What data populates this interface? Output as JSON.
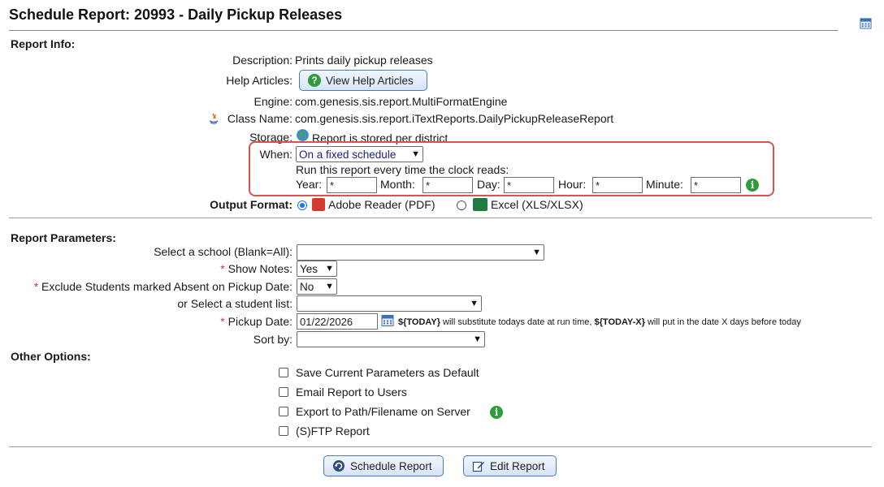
{
  "header": {
    "title": "Schedule Report: 20993 - Daily Pickup Releases"
  },
  "report_info": {
    "section_label": "Report Info:",
    "description_label": "Description:",
    "description_value": "Prints daily pickup releases",
    "help_label": "Help Articles:",
    "help_button": "View Help Articles",
    "engine_label": "Engine:",
    "engine_value": "com.genesis.sis.report.MultiFormatEngine",
    "class_label": "Class Name:",
    "class_value": "com.genesis.sis.report.iTextReports.DailyPickupReleaseReport",
    "storage_label": "Storage:",
    "storage_value": "Report is stored per district",
    "when_label": "When:",
    "when_value": "On a fixed schedule",
    "schedule_note": "Run this report every time the clock reads:",
    "year_label": "Year:",
    "year_value": "*",
    "month_label": "Month:",
    "month_value": "*",
    "day_label": "Day:",
    "day_value": "*",
    "hour_label": "Hour:",
    "hour_value": "*",
    "minute_label": "Minute:",
    "minute_value": "*",
    "output_label": "Output Format:",
    "output_pdf": "Adobe Reader (PDF)",
    "output_xls": "Excel (XLS/XLSX)"
  },
  "parameters": {
    "section_label": "Report Parameters:",
    "school_label": "Select a school (Blank=All):",
    "school_value": "",
    "notes_label": "Show Notes:",
    "notes_value": "Yes",
    "exclude_label": "Exclude Students marked Absent on Pickup Date:",
    "exclude_value": "No",
    "student_list_label": "or Select a student list:",
    "student_list_value": "",
    "pickup_label": "Pickup Date:",
    "pickup_value": "01/22/2026",
    "pickup_today_token": "${TODAY}",
    "pickup_hint_mid": " will substitute todays date at run time, ",
    "pickup_todayx_token": "${TODAY-X}",
    "pickup_hint_end": " will put in the date X days before today",
    "sort_label": "Sort by:",
    "sort_value": ""
  },
  "other_options": {
    "section_label": "Other Options:",
    "save_default": "Save Current Parameters as Default",
    "email_users": "Email Report to Users",
    "export_path": "Export to Path/Filename on Server",
    "ftp": "(S)FTP Report"
  },
  "actions": {
    "schedule_button": "Schedule Report",
    "edit_button": "Edit Report"
  },
  "colors": {
    "accent_border": "#d9534f",
    "help_green": "#2f9b3a",
    "button_border": "#4c7ab8"
  }
}
